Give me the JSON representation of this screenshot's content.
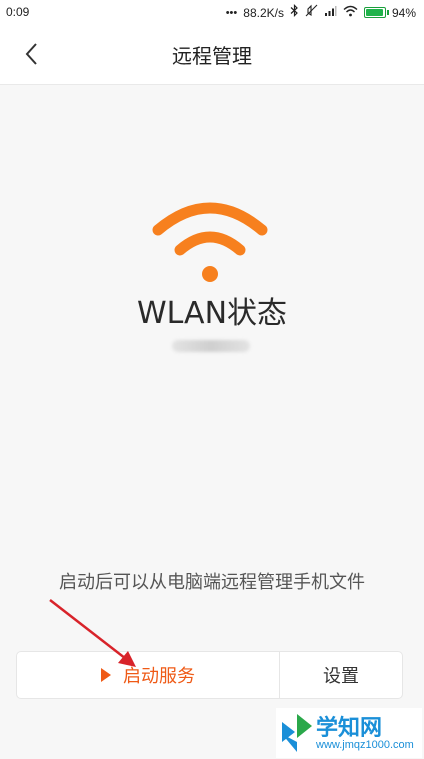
{
  "status_bar": {
    "time": "0:09",
    "network_speed": "88.2K/s",
    "battery_percent": "94%",
    "battery_level": 0.94,
    "icons": [
      "dots-icon",
      "bluetooth-icon",
      "mute-icon",
      "signal-icon",
      "wifi-icon",
      "battery-icon"
    ]
  },
  "header": {
    "title": "远程管理",
    "back_icon": "chevron-left-icon"
  },
  "main": {
    "status_icon": "wifi-icon",
    "status_title": "WLAN状态",
    "hint": "启动后可以从电脑端远程管理手机文件"
  },
  "actions": {
    "start_label": "启动服务",
    "start_icon": "play-icon",
    "settings_label": "设置"
  },
  "watermark": {
    "main": "学知网",
    "sub": "www.jmqz1000.com"
  },
  "colors": {
    "accent": "#ef5a16",
    "wifi_orange": "#f7801e",
    "annotation_arrow": "#d8232a",
    "watermark_blue": "#1a8fd8"
  }
}
